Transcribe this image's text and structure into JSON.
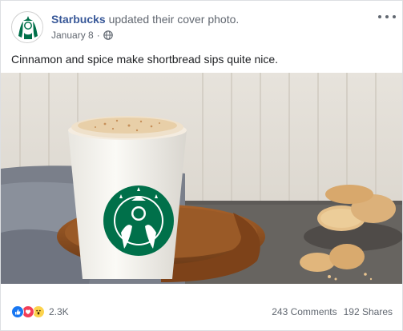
{
  "post": {
    "page_name": "Starbucks",
    "action_text": "updated their cover photo.",
    "date": "January 8",
    "separator": "·",
    "privacy_icon": "globe-icon",
    "caption": "Cinnamon and spice make shortbread sips quite nice."
  },
  "footer": {
    "reaction_icons": [
      "like-icon",
      "love-icon",
      "wow-icon"
    ],
    "reaction_count": "2.3K",
    "comments": "243 Comments",
    "shares": "192 Shares"
  },
  "colors": {
    "link": "#385898",
    "like": "#1877f2",
    "love": "#f33e58",
    "wow": "#fcd34d",
    "starbucks_green": "#00704a"
  }
}
